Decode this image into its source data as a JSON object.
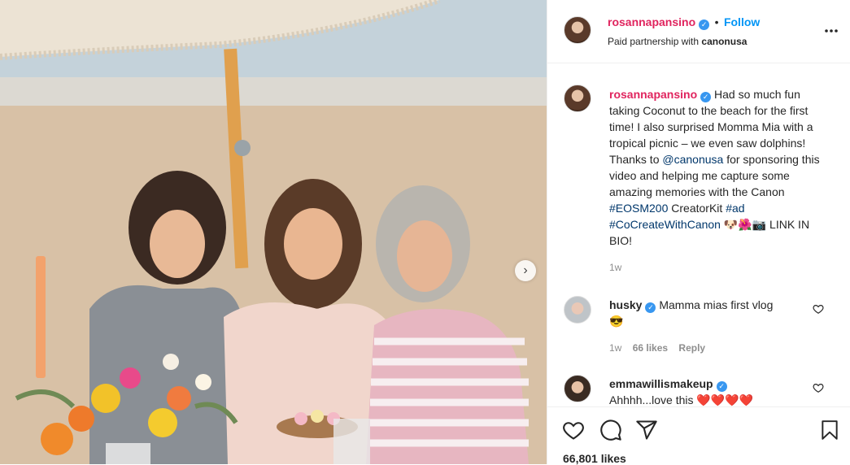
{
  "post": {
    "author": "rosannapansino",
    "follow_label": "Follow",
    "separator": "•",
    "paid_partnership_prefix": "Paid partnership with",
    "partner": "canonusa",
    "more_icon": "more-horizontal-icon",
    "caption": {
      "author": "rosannapansino",
      "text_1": "Had so much fun taking Coconut to the beach for the first time! I also surprised Momma Mia with a tropical picnic – we even saw dolphins! Thanks to",
      "mention": "@canonusa",
      "text_2": "for sponsoring this video and helping me capture some amazing memories with the Canon",
      "hashtag_1": "#EOSM200",
      "text_3": "CreatorKit",
      "hashtag_2": "#ad",
      "hashtag_3": "#CoCreateWithCanon",
      "emojis": "🐶🌺📷",
      "text_4": "LINK IN BIO!",
      "time": "1w"
    },
    "comments": [
      {
        "author": "husky",
        "text": "Mamma mias first vlog",
        "emoji": "😎",
        "time": "1w",
        "likes": "66 likes",
        "reply_label": "Reply"
      },
      {
        "author": "emmawillismakeup",
        "text": "Ahhhh...love this",
        "emoji": "❤️❤️❤️❤️"
      }
    ],
    "like_count": "66,801 likes"
  },
  "colors": {
    "handle": "#e0245e",
    "follow": "#0095f6",
    "verified": "#3897f0",
    "link": "#00376b"
  }
}
